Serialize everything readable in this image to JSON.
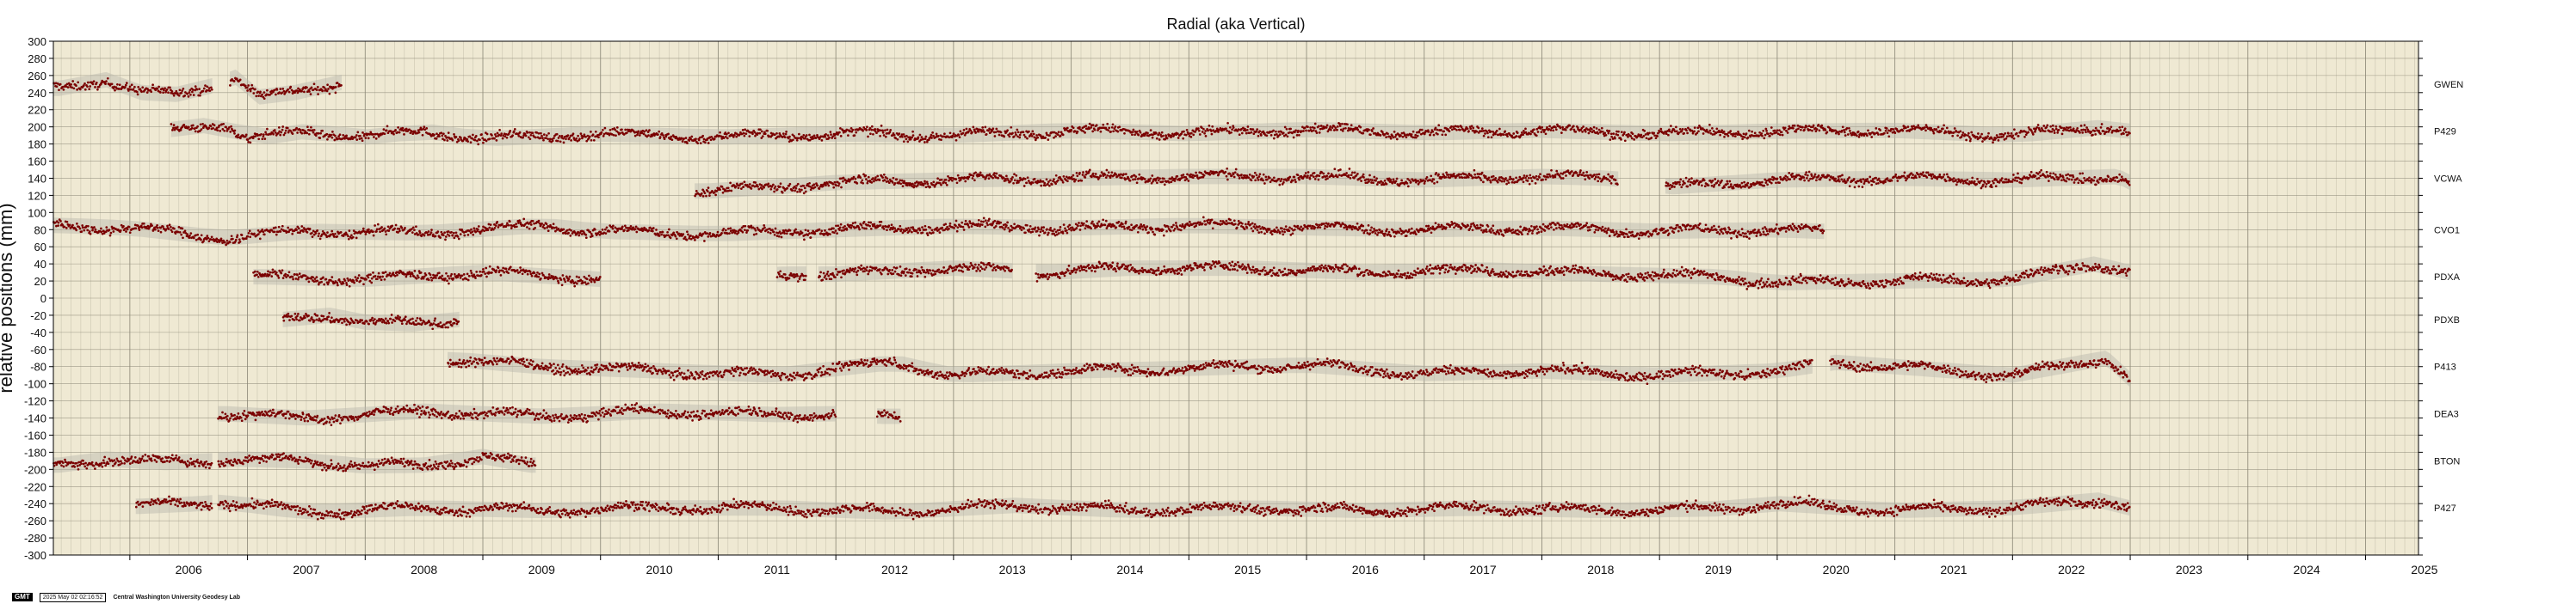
{
  "chart_data": {
    "type": "scatter",
    "title": "Radial (aka Vertical)",
    "ylabel": "relative positions (mm)",
    "xlabel": "",
    "xlim": [
      2005.35,
      2025.45
    ],
    "ylim": [
      -300,
      300
    ],
    "x_ticks": [
      "2006",
      "2007",
      "2008",
      "2009",
      "2010",
      "2011",
      "2012",
      "2013",
      "2014",
      "2015",
      "2016",
      "2017",
      "2018",
      "2019",
      "2020",
      "2021",
      "2022",
      "2023",
      "2024",
      "2025"
    ],
    "y_ticks": [
      300,
      280,
      260,
      240,
      220,
      200,
      180,
      160,
      140,
      120,
      100,
      80,
      60,
      40,
      20,
      0,
      -20,
      -40,
      -60,
      -80,
      -100,
      -120,
      -140,
      -160,
      -180,
      -200,
      -220,
      -240,
      -260,
      -280,
      -300
    ],
    "grid": true,
    "colors": {
      "background": "#efe9d3",
      "grid": "#8a8675",
      "points": "#7a0000",
      "uncertainty": "#b8b5aa"
    },
    "series": [
      {
        "name": "GWEN",
        "offset": 250,
        "segments": [
          [
            2005.35,
            2006.7
          ],
          [
            2006.85,
            2007.8
          ]
        ],
        "points": [
          [
            2005.4,
            245
          ],
          [
            2005.8,
            255
          ],
          [
            2006.1,
            240
          ],
          [
            2006.4,
            238
          ],
          [
            2006.7,
            248
          ],
          [
            2006.9,
            258
          ],
          [
            2007.1,
            235
          ],
          [
            2007.4,
            240
          ],
          [
            2007.8,
            252
          ]
        ]
      },
      {
        "name": "P429",
        "offset": 195,
        "segments": [
          [
            2006.35,
            2023.0
          ]
        ],
        "points": [
          [
            2006.4,
            197
          ],
          [
            2006.8,
            205
          ],
          [
            2007.0,
            185
          ],
          [
            2007.5,
            195
          ],
          [
            2008.0,
            188
          ],
          [
            2008.5,
            195
          ],
          [
            2009.0,
            186
          ],
          [
            2010.0,
            192
          ],
          [
            2011.0,
            188
          ],
          [
            2012.0,
            192
          ],
          [
            2013.0,
            190
          ],
          [
            2014.0,
            196
          ],
          [
            2015.0,
            192
          ],
          [
            2016.0,
            197
          ],
          [
            2017.0,
            193
          ],
          [
            2018.0,
            196
          ],
          [
            2019.0,
            192
          ],
          [
            2020.0,
            195
          ],
          [
            2021.0,
            196
          ],
          [
            2022.0,
            190
          ],
          [
            2022.8,
            200
          ],
          [
            2023.0,
            195
          ]
        ]
      },
      {
        "name": "VCWA",
        "offset": 140,
        "segments": [
          [
            2010.8,
            2018.65
          ],
          [
            2019.05,
            2023.0
          ]
        ],
        "points": [
          [
            2010.9,
            125
          ],
          [
            2011.5,
            130
          ],
          [
            2012.0,
            135
          ],
          [
            2013.0,
            138
          ],
          [
            2014.0,
            140
          ],
          [
            2015.0,
            142
          ],
          [
            2016.0,
            142
          ],
          [
            2017.0,
            138
          ],
          [
            2018.0,
            142
          ],
          [
            2018.6,
            140
          ],
          [
            2019.1,
            130
          ],
          [
            2020.0,
            138
          ],
          [
            2021.0,
            140
          ],
          [
            2022.0,
            138
          ],
          [
            2022.9,
            142
          ],
          [
            2023.0,
            135
          ]
        ]
      },
      {
        "name": "CVO1",
        "offset": 80,
        "segments": [
          [
            2005.35,
            2020.4
          ]
        ],
        "points": [
          [
            2005.4,
            85
          ],
          [
            2006.0,
            82
          ],
          [
            2006.8,
            70
          ],
          [
            2007.5,
            78
          ],
          [
            2008.5,
            76
          ],
          [
            2009.5,
            85
          ],
          [
            2010.0,
            78
          ],
          [
            2011.0,
            75
          ],
          [
            2012.0,
            80
          ],
          [
            2013.0,
            84
          ],
          [
            2014.0,
            82
          ],
          [
            2015.0,
            85
          ],
          [
            2016.0,
            82
          ],
          [
            2017.0,
            80
          ],
          [
            2018.0,
            82
          ],
          [
            2019.0,
            78
          ],
          [
            2020.0,
            80
          ],
          [
            2020.4,
            78
          ]
        ]
      },
      {
        "name": "PDXA",
        "offset": 25,
        "segments": [
          [
            2007.05,
            2010.0
          ],
          [
            2011.5,
            2011.75
          ],
          [
            2011.85,
            2013.5
          ],
          [
            2013.7,
            2023.0
          ]
        ],
        "points": [
          [
            2007.1,
            25
          ],
          [
            2008.0,
            22
          ],
          [
            2009.0,
            30
          ],
          [
            2010.0,
            22
          ],
          [
            2011.6,
            28
          ],
          [
            2012.0,
            28
          ],
          [
            2013.0,
            35
          ],
          [
            2013.8,
            30
          ],
          [
            2014.5,
            35
          ],
          [
            2015.5,
            35
          ],
          [
            2016.5,
            30
          ],
          [
            2017.5,
            33
          ],
          [
            2018.5,
            28
          ],
          [
            2019.5,
            25
          ],
          [
            2020.0,
            18
          ],
          [
            2021.0,
            20
          ],
          [
            2022.0,
            22
          ],
          [
            2022.7,
            40
          ],
          [
            2023.0,
            30
          ]
        ]
      },
      {
        "name": "PDXB",
        "offset": -25,
        "segments": [
          [
            2007.3,
            2008.8
          ]
        ],
        "points": [
          [
            2007.3,
            -25
          ],
          [
            2007.7,
            -20
          ],
          [
            2008.0,
            -28
          ],
          [
            2008.4,
            -30
          ],
          [
            2008.8,
            -25
          ]
        ]
      },
      {
        "name": "P413",
        "offset": -80,
        "segments": [
          [
            2008.7,
            2020.3
          ],
          [
            2020.45,
            2023.0
          ]
        ],
        "points": [
          [
            2008.8,
            -72
          ],
          [
            2009.5,
            -80
          ],
          [
            2010.5,
            -85
          ],
          [
            2011.5,
            -90
          ],
          [
            2012.5,
            -75
          ],
          [
            2013.0,
            -90
          ],
          [
            2014.0,
            -85
          ],
          [
            2015.0,
            -82
          ],
          [
            2016.0,
            -78
          ],
          [
            2017.0,
            -88
          ],
          [
            2018.0,
            -85
          ],
          [
            2019.0,
            -90
          ],
          [
            2020.0,
            -85
          ],
          [
            2020.5,
            -75
          ],
          [
            2021.5,
            -85
          ],
          [
            2022.0,
            -90
          ],
          [
            2022.8,
            -70
          ],
          [
            2023.0,
            -95
          ]
        ]
      },
      {
        "name": "DEA3",
        "offset": -135,
        "segments": [
          [
            2006.75,
            2012.0
          ],
          [
            2012.35,
            2012.55
          ]
        ],
        "points": [
          [
            2006.8,
            -135
          ],
          [
            2007.5,
            -140
          ],
          [
            2008.5,
            -132
          ],
          [
            2009.5,
            -138
          ],
          [
            2010.5,
            -132
          ],
          [
            2011.5,
            -136
          ],
          [
            2012.0,
            -135
          ],
          [
            2012.4,
            -138
          ]
        ]
      },
      {
        "name": "BTON",
        "offset": -190,
        "segments": [
          [
            2005.35,
            2006.7
          ],
          [
            2006.75,
            2009.45
          ]
        ],
        "points": [
          [
            2005.4,
            -195
          ],
          [
            2005.8,
            -188
          ],
          [
            2006.3,
            -192
          ],
          [
            2006.7,
            -190
          ],
          [
            2006.9,
            -188
          ],
          [
            2007.5,
            -190
          ],
          [
            2008.0,
            -196
          ],
          [
            2008.5,
            -195
          ],
          [
            2009.0,
            -185
          ],
          [
            2009.4,
            -195
          ]
        ]
      },
      {
        "name": "P427",
        "offset": -245,
        "segments": [
          [
            2006.05,
            2006.7
          ],
          [
            2006.75,
            2023.0
          ]
        ],
        "points": [
          [
            2006.1,
            -243
          ],
          [
            2006.6,
            -240
          ],
          [
            2006.8,
            -238
          ],
          [
            2007.5,
            -250
          ],
          [
            2008.5,
            -245
          ],
          [
            2009.5,
            -248
          ],
          [
            2010.5,
            -245
          ],
          [
            2011.5,
            -245
          ],
          [
            2012.5,
            -250
          ],
          [
            2013.5,
            -242
          ],
          [
            2014.5,
            -248
          ],
          [
            2015.5,
            -245
          ],
          [
            2016.5,
            -248
          ],
          [
            2017.5,
            -245
          ],
          [
            2018.5,
            -248
          ],
          [
            2019.5,
            -246
          ],
          [
            2020.0,
            -240
          ],
          [
            2021.0,
            -248
          ],
          [
            2022.0,
            -245
          ],
          [
            2022.8,
            -235
          ],
          [
            2023.0,
            -245
          ]
        ]
      }
    ]
  },
  "footer": {
    "logo": "GMT",
    "timestamp": "2025 May 02 02:16:52",
    "credit": "Central Washington University Geodesy Lab"
  }
}
